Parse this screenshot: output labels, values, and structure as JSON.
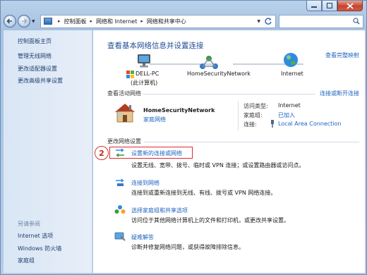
{
  "address": {
    "crumbs": [
      "控制面板",
      "网络和 Internet",
      "网络和共享中心"
    ]
  },
  "sidebar": {
    "home": "控制面板主页",
    "items": [
      "管理无线网络",
      "更改适配器设置",
      "更改高级共享设置"
    ],
    "see_also_title": "另请参阅",
    "see_also": [
      "Internet 选项",
      "Windows 防火墙",
      "家庭组"
    ]
  },
  "main": {
    "title": "查看基本网络信息并设置连接",
    "full_map": "查看完整映射",
    "map": {
      "pc_name": "DELL-PC",
      "pc_sub": "(此计算机)",
      "network": "HomeSecurityNetwork",
      "internet": "Internet"
    },
    "active": {
      "header": "查看活动网络",
      "connect_link": "连接或断开连接",
      "network_name": "HomeSecurityNetwork",
      "network_type": "家庭网络",
      "access_label": "访问类型:",
      "access_value": "Internet",
      "homegroup_label": "家庭组:",
      "homegroup_value": "已加入",
      "conn_label": "连接:",
      "conn_value": "Local Area Connection"
    },
    "change": {
      "header": "更改网络设置",
      "step_badge": "2",
      "tasks": [
        {
          "title": "设置新的连接或网络",
          "desc": "设置无线、宽带、拨号、临时或 VPN 连接；或设置路由器或访问点。"
        },
        {
          "title": "连接到网络",
          "desc": "连接到或重新连接到无线、有线、拨号或 VPN 网络连接。"
        },
        {
          "title": "选择家庭组和共享选项",
          "desc": "访问位于其他网络计算机上的文件和打印机，或更改共享设置。"
        },
        {
          "title": "疑难解答",
          "desc": "诊断并修复网络问题，或获得故障排除信息。"
        }
      ]
    }
  },
  "colors": {
    "link": "#1e63c0",
    "title": "#1e4c94",
    "highlight_box": "#e0282d"
  }
}
